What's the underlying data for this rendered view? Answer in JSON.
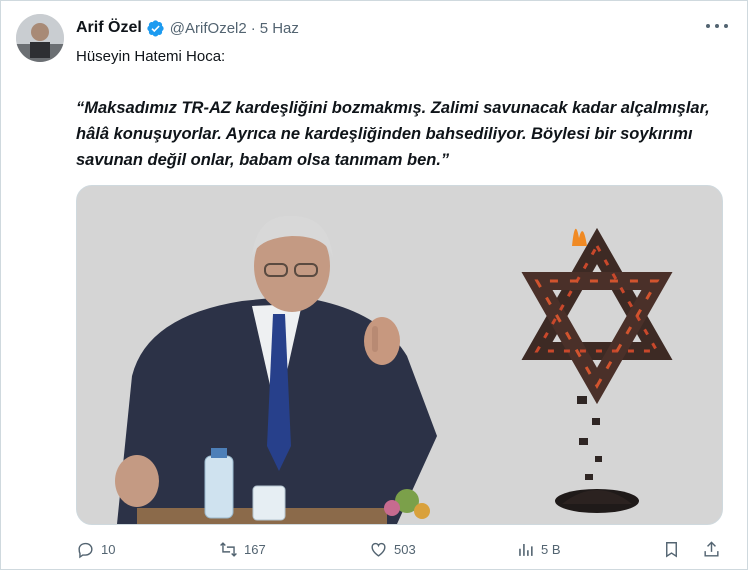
{
  "tweet": {
    "author_name": "Arif Özel",
    "handle": "@ArifOzel2",
    "separator": "·",
    "time": "5 Haz",
    "intro": "Hüseyin Hatemi Hoca:",
    "quote": "“Maksadımız TR-AZ kardeşliğini bozmakmış. Zalimi savunacak kadar alçalmışlar, hâlâ konuşuyorlar. Ayrıca ne kardeşliğinden bahsediliyor. Böylesi bir soykırımı savunan değil onlar, babam olsa tanımam ben.”"
  },
  "actions": {
    "replies": "10",
    "reposts": "167",
    "likes": "503",
    "views": "5 B"
  },
  "colors": {
    "text": "#0f1419",
    "secondary": "#536471",
    "verified": "#1d9bf0",
    "media_bg": "#d5d5d5"
  },
  "icons": [
    "verified-badge-icon",
    "more-icon",
    "reply-icon",
    "repost-icon",
    "like-icon",
    "views-icon",
    "bookmark-icon",
    "share-icon"
  ]
}
